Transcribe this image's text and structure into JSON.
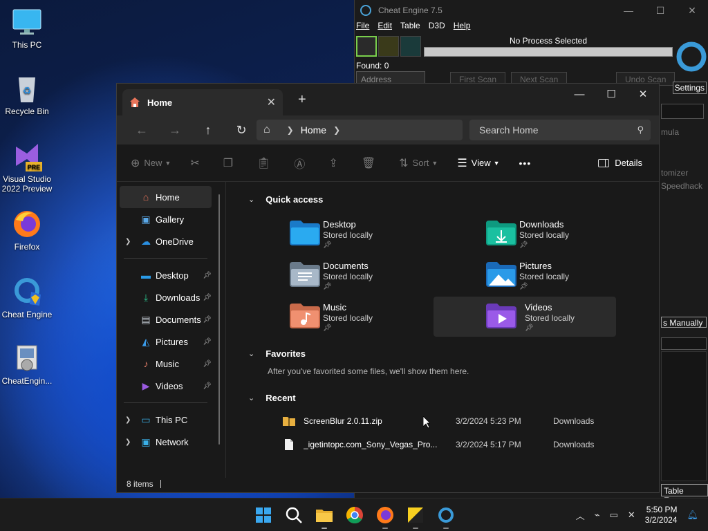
{
  "desktop": {
    "icons": [
      {
        "label": "This PC"
      },
      {
        "label": "Recycle Bin"
      },
      {
        "label": "Visual Studio\n2022 Preview",
        "label_l1": "Visual Studio",
        "label_l2": "2022 Preview",
        "badge": "PRE"
      },
      {
        "label": "Firefox"
      },
      {
        "label": "Cheat Engine"
      },
      {
        "label": "CheatEngin..."
      }
    ]
  },
  "cheat_engine": {
    "title": "Cheat Engine 7.5",
    "menu": [
      "File",
      "Edit",
      "Table",
      "D3D",
      "Help"
    ],
    "process": "No Process Selected",
    "found": "Found: 0",
    "address_header": "Address",
    "first_scan": "First Scan",
    "next_scan": "Next Scan",
    "undo_scan": "Undo Scan",
    "settings": "Settings",
    "side_labels": [
      "mula",
      "tomizer",
      "Speedhack"
    ],
    "add_manually": "s Manually",
    "table_extras": "Table Extras"
  },
  "explorer": {
    "tab_title": "Home",
    "address_crumb": "Home",
    "search_placeholder": "Search Home",
    "commands": {
      "new": "New",
      "sort": "Sort",
      "view": "View",
      "more": "•••",
      "details": "Details"
    },
    "sidebar": {
      "top": [
        {
          "label": "Home",
          "icon": "home-icon",
          "selected": true
        },
        {
          "label": "Gallery",
          "icon": "gallery-icon"
        },
        {
          "label": "OneDrive",
          "icon": "onedrive-icon",
          "expandable": true
        }
      ],
      "pinned": [
        {
          "label": "Desktop",
          "icon": "desktop-folder-icon"
        },
        {
          "label": "Downloads",
          "icon": "downloads-folder-icon"
        },
        {
          "label": "Documents",
          "icon": "documents-folder-icon"
        },
        {
          "label": "Pictures",
          "icon": "pictures-folder-icon"
        },
        {
          "label": "Music",
          "icon": "music-folder-icon"
        },
        {
          "label": "Videos",
          "icon": "videos-folder-icon"
        }
      ],
      "bottom": [
        {
          "label": "This PC",
          "icon": "this-pc-icon"
        },
        {
          "label": "Network",
          "icon": "network-icon"
        }
      ]
    },
    "quick_access": {
      "header": "Quick access",
      "items": [
        {
          "name": "Desktop",
          "status": "Stored locally",
          "color": "#1e9be8"
        },
        {
          "name": "Downloads",
          "status": "Stored locally",
          "color": "#12b59a"
        },
        {
          "name": "Documents",
          "status": "Stored locally",
          "color": "#8aa0b4"
        },
        {
          "name": "Pictures",
          "status": "Stored locally",
          "color": "#2a8fe0"
        },
        {
          "name": "Music",
          "status": "Stored locally",
          "color": "#e8805a"
        },
        {
          "name": "Videos",
          "status": "Stored locally",
          "color": "#8a4ad8"
        }
      ]
    },
    "favorites": {
      "header": "Favorites",
      "empty_text": "After you've favorited some files, we'll show them here."
    },
    "recent": {
      "header": "Recent",
      "rows": [
        {
          "name": "ScreenBlur 2.0.11.zip",
          "date": "3/2/2024 5:23 PM",
          "location": "Downloads",
          "icon": "zip-folder-icon"
        },
        {
          "name": "_igetintopc.com_Sony_Vegas_Pro...",
          "date": "3/2/2024 5:17 PM",
          "location": "Downloads",
          "icon": "file-icon"
        }
      ]
    },
    "status": "8 items"
  },
  "taskbar": {
    "time": "5:50 PM",
    "date": "3/2/2024"
  }
}
